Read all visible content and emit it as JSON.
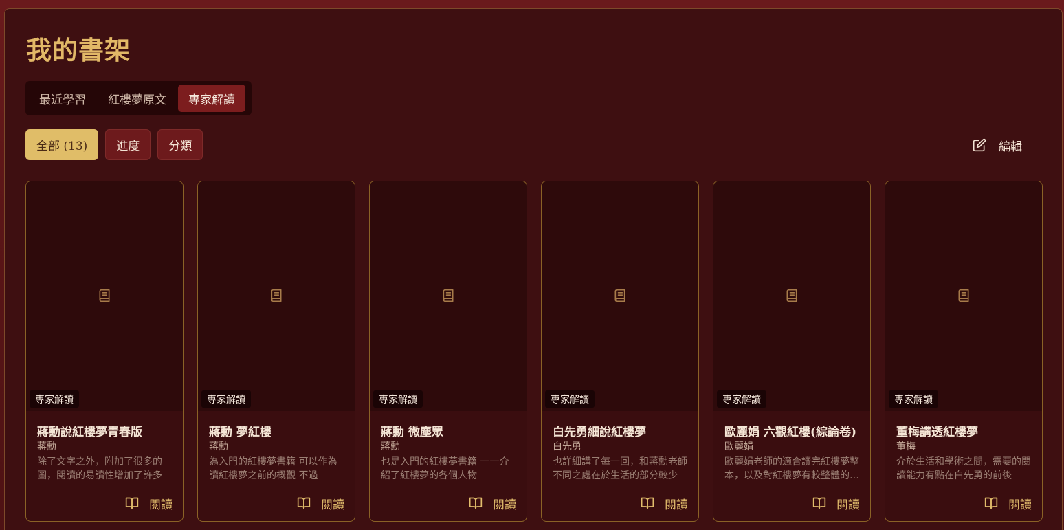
{
  "header": {
    "title": "我的書架"
  },
  "tabs": [
    {
      "label": "最近學習",
      "active": false
    },
    {
      "label": "紅樓夢原文",
      "active": false
    },
    {
      "label": "專家解讀",
      "active": true
    }
  ],
  "filters": [
    {
      "label": "全部 (13)",
      "active": true
    },
    {
      "label": "進度",
      "active": false
    },
    {
      "label": "分類",
      "active": false
    }
  ],
  "edit": {
    "label": "編輯",
    "icon": "edit-icon"
  },
  "books": [
    {
      "badge": "專家解讀",
      "title": "蔣勳說紅樓夢青春版",
      "author": "蔣勳",
      "description": "除了文字之外，附加了很多的圖，閱讀的易讀性增加了許多",
      "action": "閱讀"
    },
    {
      "badge": "專家解讀",
      "title": "蔣勳 夢紅樓",
      "author": "蔣勳",
      "description": "為入門的紅樓夢書籍 可以作為讀紅樓夢之前的概觀 不過",
      "action": "閱讀"
    },
    {
      "badge": "專家解讀",
      "title": "蔣勳 微塵眾",
      "author": "蔣勳",
      "description": "也是入門的紅樓夢書籍 一一介紹了紅樓夢的各個人物",
      "action": "閱讀"
    },
    {
      "badge": "專家解讀",
      "title": "白先勇細說紅樓夢",
      "author": "白先勇",
      "description": "也詳細講了每一回，和蔣勳老師不同之處在於生活的部分較少",
      "action": "閱讀"
    },
    {
      "badge": "專家解讀",
      "title": "歐麗娟 六觀紅樓(綜論卷)",
      "author": "歐麗娟",
      "description": "歐麗娟老師的適合讀完紅樓夢整本，以及對紅樓夢有較整體的了解",
      "action": "閱讀"
    },
    {
      "badge": "專家解讀",
      "title": "董梅講透紅樓夢",
      "author": "董梅",
      "description": "介於生活和學術之間，需要的閱讀能力有點在白先勇的前後",
      "action": "閱讀"
    }
  ],
  "colors": {
    "accent_gold": "#e2b867",
    "tab_active_bg": "#7c1d1e",
    "filter_active_bg": "#e0bd68",
    "panel_bg": "#3e0f11",
    "card_border": "#8a6226"
  }
}
